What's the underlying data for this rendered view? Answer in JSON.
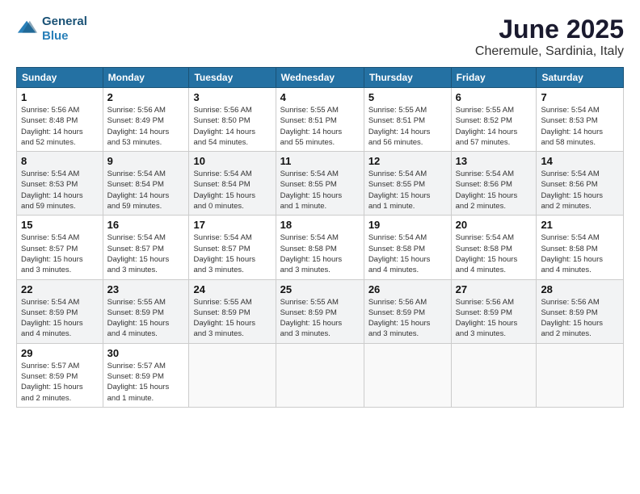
{
  "header": {
    "logo_line1": "General",
    "logo_line2": "Blue",
    "month": "June 2025",
    "location": "Cheremule, Sardinia, Italy"
  },
  "days_of_week": [
    "Sunday",
    "Monday",
    "Tuesday",
    "Wednesday",
    "Thursday",
    "Friday",
    "Saturday"
  ],
  "weeks": [
    [
      {
        "day": "1",
        "info": "Sunrise: 5:56 AM\nSunset: 8:48 PM\nDaylight: 14 hours\nand 52 minutes."
      },
      {
        "day": "2",
        "info": "Sunrise: 5:56 AM\nSunset: 8:49 PM\nDaylight: 14 hours\nand 53 minutes."
      },
      {
        "day": "3",
        "info": "Sunrise: 5:56 AM\nSunset: 8:50 PM\nDaylight: 14 hours\nand 54 minutes."
      },
      {
        "day": "4",
        "info": "Sunrise: 5:55 AM\nSunset: 8:51 PM\nDaylight: 14 hours\nand 55 minutes."
      },
      {
        "day": "5",
        "info": "Sunrise: 5:55 AM\nSunset: 8:51 PM\nDaylight: 14 hours\nand 56 minutes."
      },
      {
        "day": "6",
        "info": "Sunrise: 5:55 AM\nSunset: 8:52 PM\nDaylight: 14 hours\nand 57 minutes."
      },
      {
        "day": "7",
        "info": "Sunrise: 5:54 AM\nSunset: 8:53 PM\nDaylight: 14 hours\nand 58 minutes."
      }
    ],
    [
      {
        "day": "8",
        "info": "Sunrise: 5:54 AM\nSunset: 8:53 PM\nDaylight: 14 hours\nand 59 minutes."
      },
      {
        "day": "9",
        "info": "Sunrise: 5:54 AM\nSunset: 8:54 PM\nDaylight: 14 hours\nand 59 minutes."
      },
      {
        "day": "10",
        "info": "Sunrise: 5:54 AM\nSunset: 8:54 PM\nDaylight: 15 hours\nand 0 minutes."
      },
      {
        "day": "11",
        "info": "Sunrise: 5:54 AM\nSunset: 8:55 PM\nDaylight: 15 hours\nand 1 minute."
      },
      {
        "day": "12",
        "info": "Sunrise: 5:54 AM\nSunset: 8:55 PM\nDaylight: 15 hours\nand 1 minute."
      },
      {
        "day": "13",
        "info": "Sunrise: 5:54 AM\nSunset: 8:56 PM\nDaylight: 15 hours\nand 2 minutes."
      },
      {
        "day": "14",
        "info": "Sunrise: 5:54 AM\nSunset: 8:56 PM\nDaylight: 15 hours\nand 2 minutes."
      }
    ],
    [
      {
        "day": "15",
        "info": "Sunrise: 5:54 AM\nSunset: 8:57 PM\nDaylight: 15 hours\nand 3 minutes."
      },
      {
        "day": "16",
        "info": "Sunrise: 5:54 AM\nSunset: 8:57 PM\nDaylight: 15 hours\nand 3 minutes."
      },
      {
        "day": "17",
        "info": "Sunrise: 5:54 AM\nSunset: 8:57 PM\nDaylight: 15 hours\nand 3 minutes."
      },
      {
        "day": "18",
        "info": "Sunrise: 5:54 AM\nSunset: 8:58 PM\nDaylight: 15 hours\nand 3 minutes."
      },
      {
        "day": "19",
        "info": "Sunrise: 5:54 AM\nSunset: 8:58 PM\nDaylight: 15 hours\nand 4 minutes."
      },
      {
        "day": "20",
        "info": "Sunrise: 5:54 AM\nSunset: 8:58 PM\nDaylight: 15 hours\nand 4 minutes."
      },
      {
        "day": "21",
        "info": "Sunrise: 5:54 AM\nSunset: 8:58 PM\nDaylight: 15 hours\nand 4 minutes."
      }
    ],
    [
      {
        "day": "22",
        "info": "Sunrise: 5:54 AM\nSunset: 8:59 PM\nDaylight: 15 hours\nand 4 minutes."
      },
      {
        "day": "23",
        "info": "Sunrise: 5:55 AM\nSunset: 8:59 PM\nDaylight: 15 hours\nand 4 minutes."
      },
      {
        "day": "24",
        "info": "Sunrise: 5:55 AM\nSunset: 8:59 PM\nDaylight: 15 hours\nand 3 minutes."
      },
      {
        "day": "25",
        "info": "Sunrise: 5:55 AM\nSunset: 8:59 PM\nDaylight: 15 hours\nand 3 minutes."
      },
      {
        "day": "26",
        "info": "Sunrise: 5:56 AM\nSunset: 8:59 PM\nDaylight: 15 hours\nand 3 minutes."
      },
      {
        "day": "27",
        "info": "Sunrise: 5:56 AM\nSunset: 8:59 PM\nDaylight: 15 hours\nand 3 minutes."
      },
      {
        "day": "28",
        "info": "Sunrise: 5:56 AM\nSunset: 8:59 PM\nDaylight: 15 hours\nand 2 minutes."
      }
    ],
    [
      {
        "day": "29",
        "info": "Sunrise: 5:57 AM\nSunset: 8:59 PM\nDaylight: 15 hours\nand 2 minutes."
      },
      {
        "day": "30",
        "info": "Sunrise: 5:57 AM\nSunset: 8:59 PM\nDaylight: 15 hours\nand 1 minute."
      },
      null,
      null,
      null,
      null,
      null
    ]
  ]
}
